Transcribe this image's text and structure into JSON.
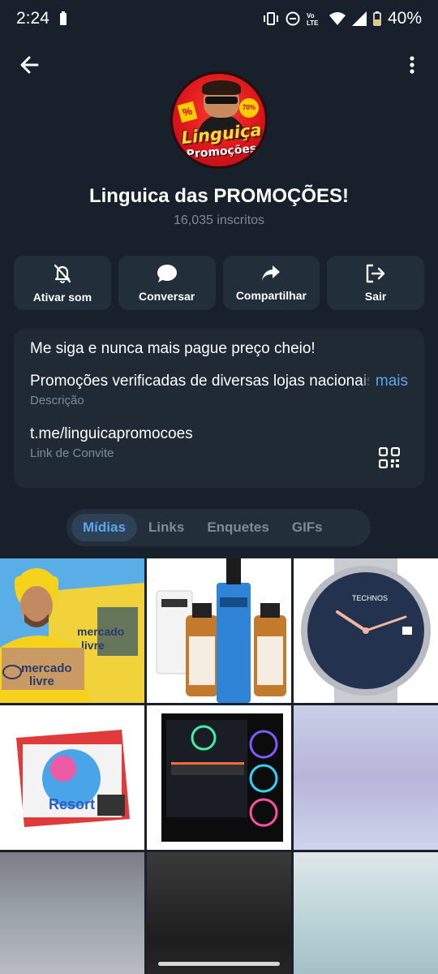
{
  "status": {
    "time": "2:24",
    "battery": "40%"
  },
  "channel": {
    "title": "Linguica das PROMOÇÕES!",
    "subscribers": "16,035 inscritos",
    "avatar_text_1": "Linguiça",
    "avatar_text_2": "Promoções"
  },
  "actions": [
    {
      "label": "Ativar som",
      "icon": "bell-off-icon"
    },
    {
      "label": "Conversar",
      "icon": "chat-icon"
    },
    {
      "label": "Compartilhar",
      "icon": "share-icon"
    },
    {
      "label": "Sair",
      "icon": "exit-icon"
    }
  ],
  "info": {
    "bio": "Me siga e nunca mais pague preço cheio!",
    "description": "Promoções verificadas de diversas lojas nacionais",
    "more_label": "mais",
    "description_caption": "Descrição",
    "invite_link": "t.me/linguicapromocoes",
    "invite_caption": "Link de Convite"
  },
  "tabs": [
    {
      "label": "Mídias",
      "active": true
    },
    {
      "label": "Links",
      "active": false
    },
    {
      "label": "Enquetes",
      "active": false
    },
    {
      "label": "GIFs",
      "active": false
    }
  ],
  "colors": {
    "background": "#18212b",
    "card": "#1f2a35",
    "accent": "#5ea5ee",
    "muted": "#7d8b99"
  },
  "media": {
    "mercado_livre_text": "mercado livre",
    "principia_text": "PRINCIPIA",
    "watch_brand": "TECHNOS",
    "game_text": "Resort"
  }
}
